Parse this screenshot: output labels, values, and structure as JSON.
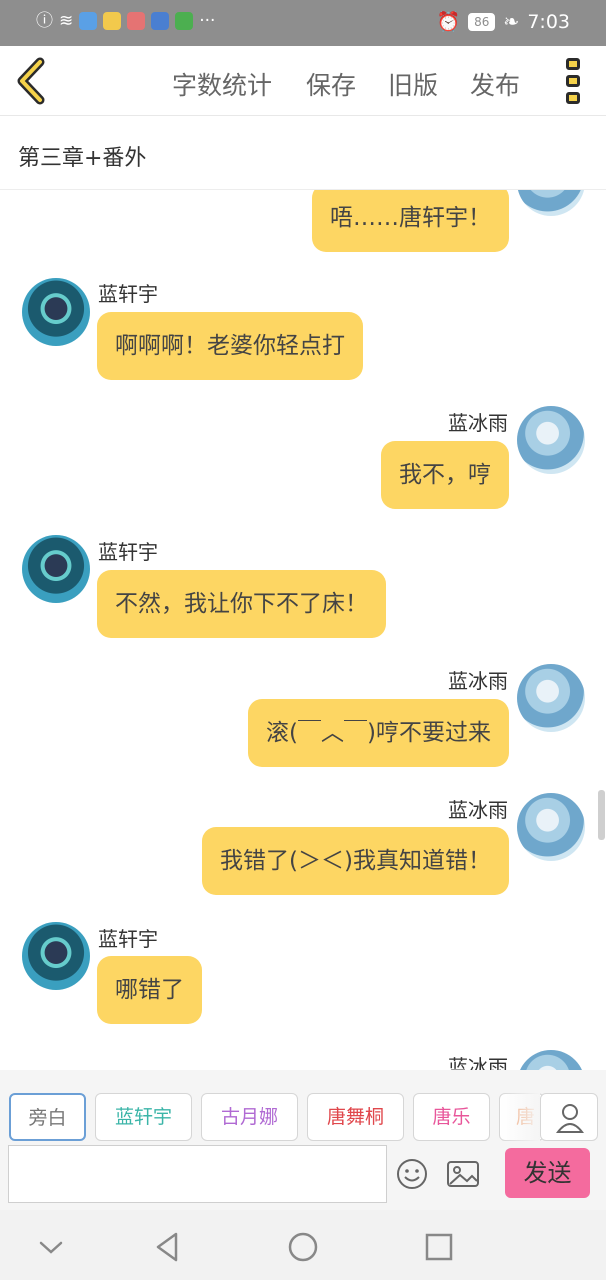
{
  "status_bar": {
    "time": "7:03",
    "battery": "86",
    "more": "···",
    "icons": [
      "alert-icon",
      "wifi-icon",
      "app-icon-1",
      "app-icon-2",
      "app-icon-3",
      "app-icon-4",
      "app-icon-5",
      "alarm-icon",
      "leaf-icon"
    ]
  },
  "toolbar": {
    "word_count": "字数统计",
    "save": "保存",
    "old_version": "旧版",
    "publish": "发布"
  },
  "chapter": {
    "title": "第三章+番外"
  },
  "messages": [
    {
      "side": "right",
      "name": "",
      "text": "唔……唐轩宇！"
    },
    {
      "side": "left",
      "name": "蓝轩宇",
      "text": "啊啊啊！老婆你轻点打"
    },
    {
      "side": "right",
      "name": "蓝冰雨",
      "text": "我不，哼"
    },
    {
      "side": "left",
      "name": "蓝轩宇",
      "text": "不然，我让你下不了床！"
    },
    {
      "side": "right",
      "name": "蓝冰雨",
      "text": "滚(￣︿￣)哼不要过来"
    },
    {
      "side": "right",
      "name": "蓝冰雨",
      "text": "我错了(＞＜)我真知道错！"
    },
    {
      "side": "left",
      "name": "蓝轩宇",
      "text": "哪错了"
    },
    {
      "side": "right",
      "name": "蓝冰雨",
      "text": ""
    }
  ],
  "roles": [
    {
      "label": "旁白",
      "color": "#777777"
    },
    {
      "label": "蓝轩宇",
      "color": "#3bb5a8"
    },
    {
      "label": "古月娜",
      "color": "#b06ad3"
    },
    {
      "label": "唐舞桐",
      "color": "#e0474c"
    },
    {
      "label": "唐乐",
      "color": "#e8569a"
    },
    {
      "label": "唐",
      "color": "#f0a070"
    }
  ],
  "input": {
    "value": "",
    "placeholder": ""
  },
  "send_label": "发送",
  "colors": {
    "bubble": "#fdd663",
    "send": "#f46b9e",
    "accent_yellow": "#f5d24a"
  }
}
